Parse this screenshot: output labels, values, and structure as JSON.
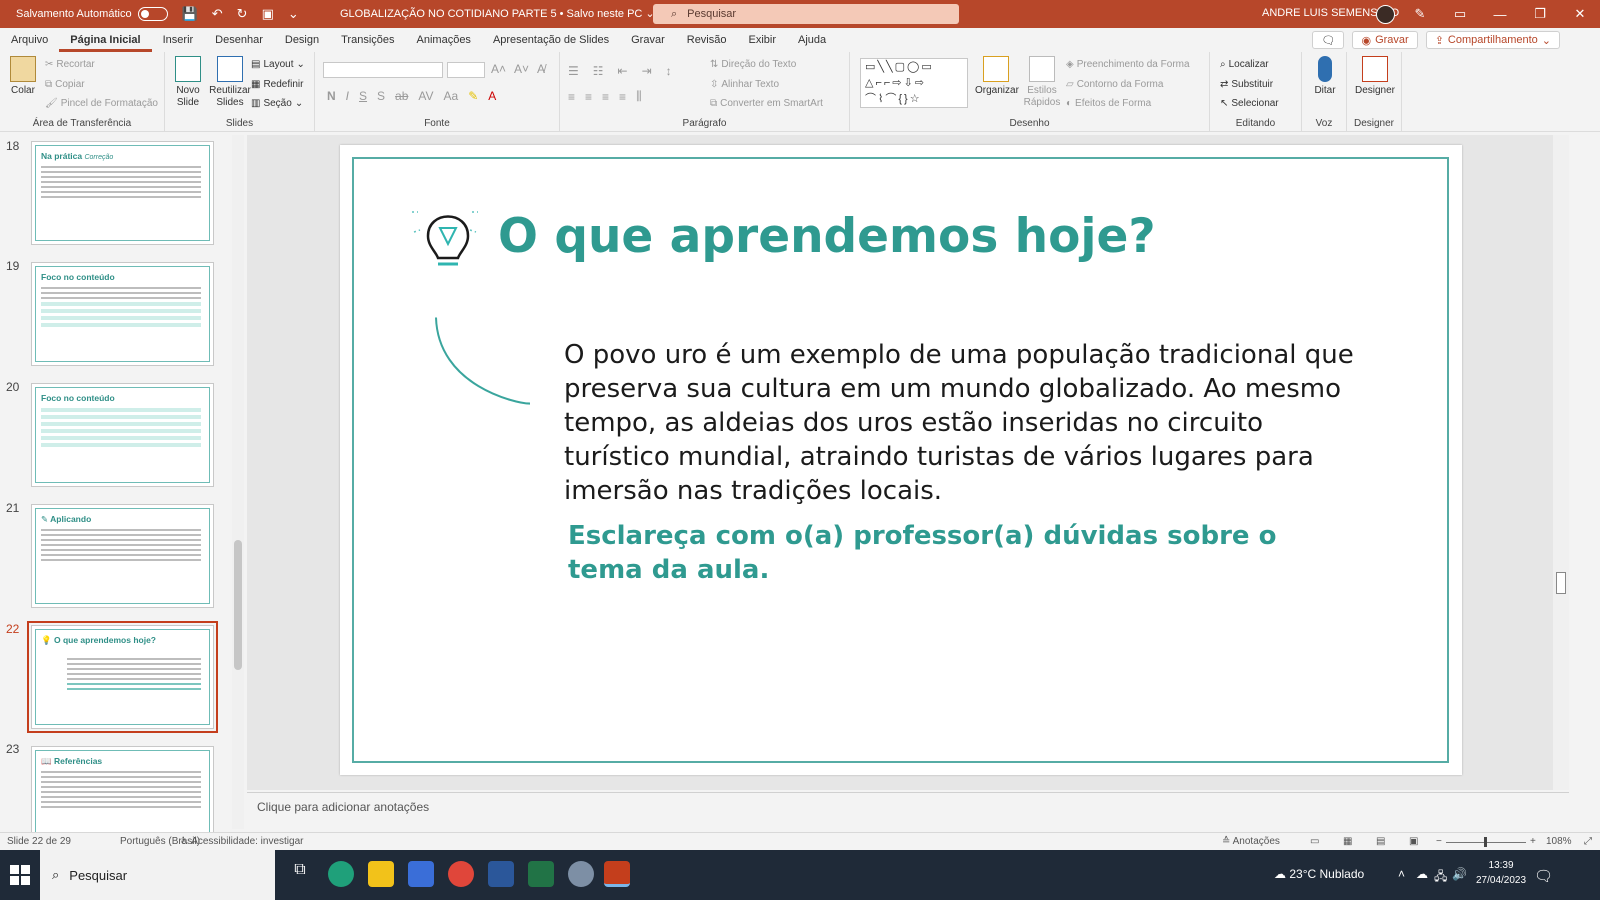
{
  "titlebar": {
    "autosave_label": "Salvamento Automático",
    "doc_title": "GLOBALIZAÇÃO NO COTIDIANO PARTE 5 • Salvo neste PC ⌄",
    "search_placeholder": "Pesquisar",
    "user_name": "ANDRE LUIS SEMENSATO",
    "accent": "#b7472a"
  },
  "menu": {
    "tabs": [
      "Arquivo",
      "Página Inicial",
      "Inserir",
      "Desenhar",
      "Design",
      "Transições",
      "Animações",
      "Apresentação de Slides",
      "Gravar",
      "Revisão",
      "Exibir",
      "Ajuda"
    ],
    "record_label": "Gravar",
    "share_label": "Compartilhamento"
  },
  "ribbon": {
    "clipboard": {
      "paste": "Colar",
      "cut": "Recortar",
      "copy": "Copiar",
      "painter": "Pincel de Formatação",
      "label": "Área de Transferência"
    },
    "slides": {
      "new": "Novo Slide",
      "reuse": "Reutilizar Slides",
      "layout": "Layout",
      "reset": "Redefinir",
      "section": "Seção",
      "label": "Slides"
    },
    "font": {
      "label": "Fonte"
    },
    "paragraph": {
      "direction": "Direção do Texto",
      "align": "Alinhar Texto",
      "smartart": "Converter em SmartArt",
      "label": "Parágrafo"
    },
    "drawing": {
      "arrange": "Organizar",
      "quick_styles": "Estilos Rápidos",
      "fill": "Preenchimento da Forma",
      "outline": "Contorno da Forma",
      "effects": "Efeitos de Forma",
      "label": "Desenho"
    },
    "editing": {
      "find": "Localizar",
      "replace": "Substituir",
      "select": "Selecionar",
      "label": "Editando"
    },
    "voice": {
      "dictate": "Ditar",
      "label": "Voz"
    },
    "designer": {
      "designer": "Designer",
      "label": "Designer"
    }
  },
  "thumbnails": [
    {
      "num": "18",
      "title": "Na prática",
      "title_suffix": "Correção",
      "selected": false
    },
    {
      "num": "19",
      "title": "Foco no conteúdo",
      "selected": false
    },
    {
      "num": "20",
      "title": "Foco no conteúdo",
      "selected": false
    },
    {
      "num": "21",
      "title": "Aplicando",
      "selected": false
    },
    {
      "num": "22",
      "title": "O que aprendemos hoje?",
      "selected": true
    },
    {
      "num": "23",
      "title": "Referências",
      "selected": false
    }
  ],
  "slide": {
    "title": "O que aprendemos hoje?",
    "body": "O povo uro é um exemplo de uma população tradicional que preserva sua cultura em um mundo globalizado. Ao mesmo tempo, as aldeias dos uros estão inseridas no circuito turístico mundial, atraindo turistas de vários lugares para imersão nas tradições locais.",
    "cta": "Esclareça com o(a) professor(a) dúvidas sobre o tema da aula.",
    "accent": "#2f9a90"
  },
  "notes_placeholder": "Clique para adicionar anotações",
  "status": {
    "slide_counter": "Slide 22 de 29",
    "language": "Português (Brasil)",
    "accessibility": "Acessibilidade: investigar",
    "notes_button": "Anotações",
    "zoom": "108%"
  },
  "taskbar": {
    "search": "Pesquisar",
    "weather": "23°C  Nublado",
    "time": "13:39",
    "date": "27/04/2023"
  }
}
